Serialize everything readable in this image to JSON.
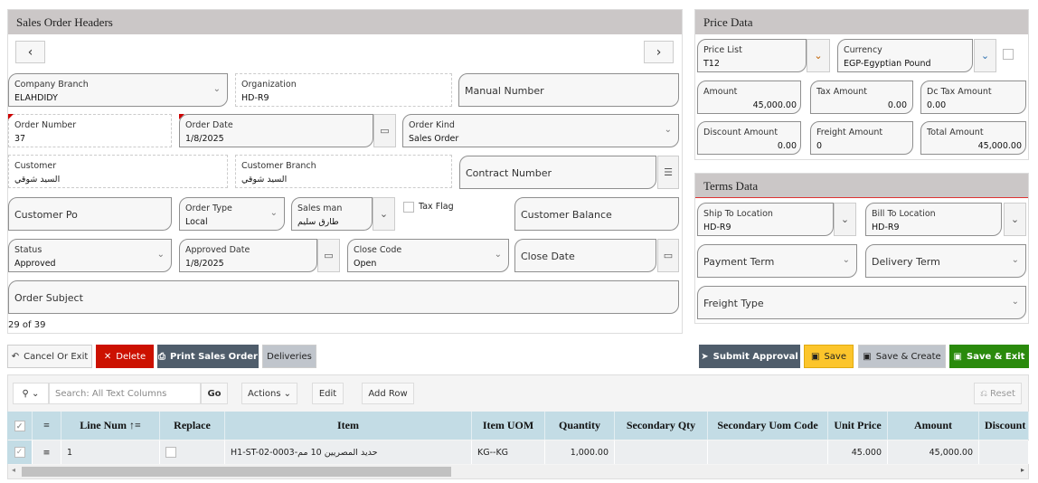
{
  "header": {
    "title": "Sales Order Headers",
    "prev": "‹",
    "next": "›",
    "record_count": "29 of 39"
  },
  "fields": {
    "company_branch": {
      "label": "Company Branch",
      "value": "ELAHDIDY"
    },
    "organization": {
      "label": "Organization",
      "value": "HD-R9"
    },
    "manual_number": {
      "label": "Manual Number"
    },
    "order_number": {
      "label": "Order Number",
      "value": "37"
    },
    "order_date": {
      "label": "Order Date",
      "value": "1/8/2025"
    },
    "order_kind": {
      "label": "Order Kind",
      "value": "Sales Order"
    },
    "customer": {
      "label": "Customer",
      "value": "السيد شوقي"
    },
    "customer_branch": {
      "label": "Customer Branch",
      "value": "السيد شوقي"
    },
    "contract_number": {
      "label": "Contract Number"
    },
    "customer_po": {
      "label": "Customer Po"
    },
    "order_type": {
      "label": "Order Type",
      "value": "Local"
    },
    "sales_man": {
      "label": "Sales man",
      "value": "طارق سليم"
    },
    "tax_flag": {
      "label": "Tax Flag"
    },
    "customer_balance": {
      "label": "Customer Balance"
    },
    "status": {
      "label": "Status",
      "value": "Approved"
    },
    "approved_date": {
      "label": "Approved Date",
      "value": "1/8/2025"
    },
    "close_code": {
      "label": "Close Code",
      "value": "Open"
    },
    "close_date": {
      "label": "Close Date"
    },
    "order_subject": {
      "label": "Order Subject"
    }
  },
  "price": {
    "title": "Price Data",
    "price_list": {
      "label": "Price List",
      "value": "T12"
    },
    "currency": {
      "label": "Currency",
      "value": "EGP-Egyptian Pound"
    },
    "amount": {
      "label": "Amount",
      "value": "45,000.00"
    },
    "tax_amount": {
      "label": "Tax Amount",
      "value": "0.00"
    },
    "dc_tax_amount": {
      "label": "Dc Tax Amount",
      "value": "0.00"
    },
    "discount_amount": {
      "label": "Discount Amount",
      "value": "0.00"
    },
    "freight_amount": {
      "label": "Freight Amount",
      "value": "0"
    },
    "total_amount": {
      "label": "Total Amount",
      "value": "45,000.00"
    }
  },
  "terms": {
    "title": "Terms Data",
    "ship_to": {
      "label": "Ship To Location",
      "value": "HD-R9"
    },
    "bill_to": {
      "label": "Bill To Location",
      "value": "HD-R9"
    },
    "payment_term": {
      "label": "Payment Term"
    },
    "delivery_term": {
      "label": "Delivery Term"
    },
    "freight_type": {
      "label": "Freight Type"
    }
  },
  "buttons": {
    "cancel": "Cancel Or Exit",
    "delete": "Delete",
    "print": "Print Sales Order",
    "deliveries": "Deliveries",
    "submit": "Submit Approval",
    "save": "Save",
    "save_create": "Save & Create",
    "save_exit": "Save & Exit"
  },
  "colors": {
    "delete": "#cc1100",
    "print": "#4f5d6b",
    "save": "#fcc52b",
    "save_exit": "#2a8a0c",
    "grid_header": "#c3dce5"
  },
  "grid": {
    "search_placeholder": "Search: All Text Columns",
    "go": "Go",
    "actions": "Actions",
    "edit": "Edit",
    "add_row": "Add Row",
    "reset": "Reset",
    "columns": [
      "Line Num",
      "Replace",
      "Item",
      "Item UOM",
      "Quantity",
      "Secondary Qty",
      "Secondary Uom Code",
      "Unit Price",
      "Amount",
      "Discount"
    ],
    "rows": [
      {
        "line_num": "1",
        "item": "H1-ST-02-0003-حديد المصريين 10 مم",
        "uom": "KG--KG",
        "quantity": "1,000.00",
        "secondary_qty": "",
        "secondary_uom": "",
        "unit_price": "45.000",
        "amount": "45,000.00",
        "discount": ""
      }
    ]
  }
}
